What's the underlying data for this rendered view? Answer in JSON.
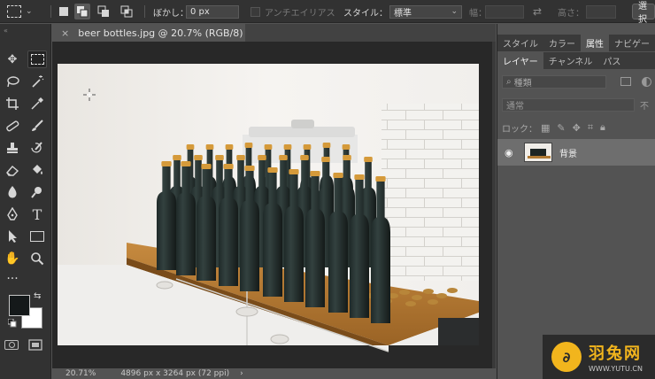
{
  "options_bar": {
    "feather_label": "ぼかし：",
    "feather_value": "0 px",
    "antialias_label": "アンチエイリアス",
    "style_label": "スタイル：",
    "style_value": "標準",
    "width_label": "幅：",
    "height_label": "高さ：",
    "select_mask_button": "選択"
  },
  "document": {
    "tab_title": "beer bottles.jpg @ 20.7% (RGB/8)",
    "close_glyph": "×"
  },
  "status_bar": {
    "zoom": "20.71%",
    "dimensions": "4896 px x 3264 px (72 ppi)",
    "arrow": "›"
  },
  "panels": {
    "top_tabs": [
      "スタイル",
      "カラー",
      "属性",
      "ナビゲー"
    ],
    "active_top_tab": 2,
    "layer_tabs": [
      "レイヤー",
      "チャンネル",
      "パス"
    ],
    "active_layer_tab": 0,
    "filter_kind": "種類",
    "blend_mode": "通常",
    "opacity_label": "不",
    "lock_label": "ロック：",
    "layers": [
      {
        "name": "背景",
        "visible": true
      }
    ]
  },
  "watermark": {
    "brand_cn": "羽兔网",
    "brand_url": "WWW.YUTU.CN"
  },
  "colors": {
    "ui_dark": "#323232",
    "ui_mid": "#535353",
    "canvas_bg": "#282828",
    "foreground_swatch": "#15191a",
    "background_swatch": "#ffffff",
    "watermark_accent": "#f2b51d"
  }
}
